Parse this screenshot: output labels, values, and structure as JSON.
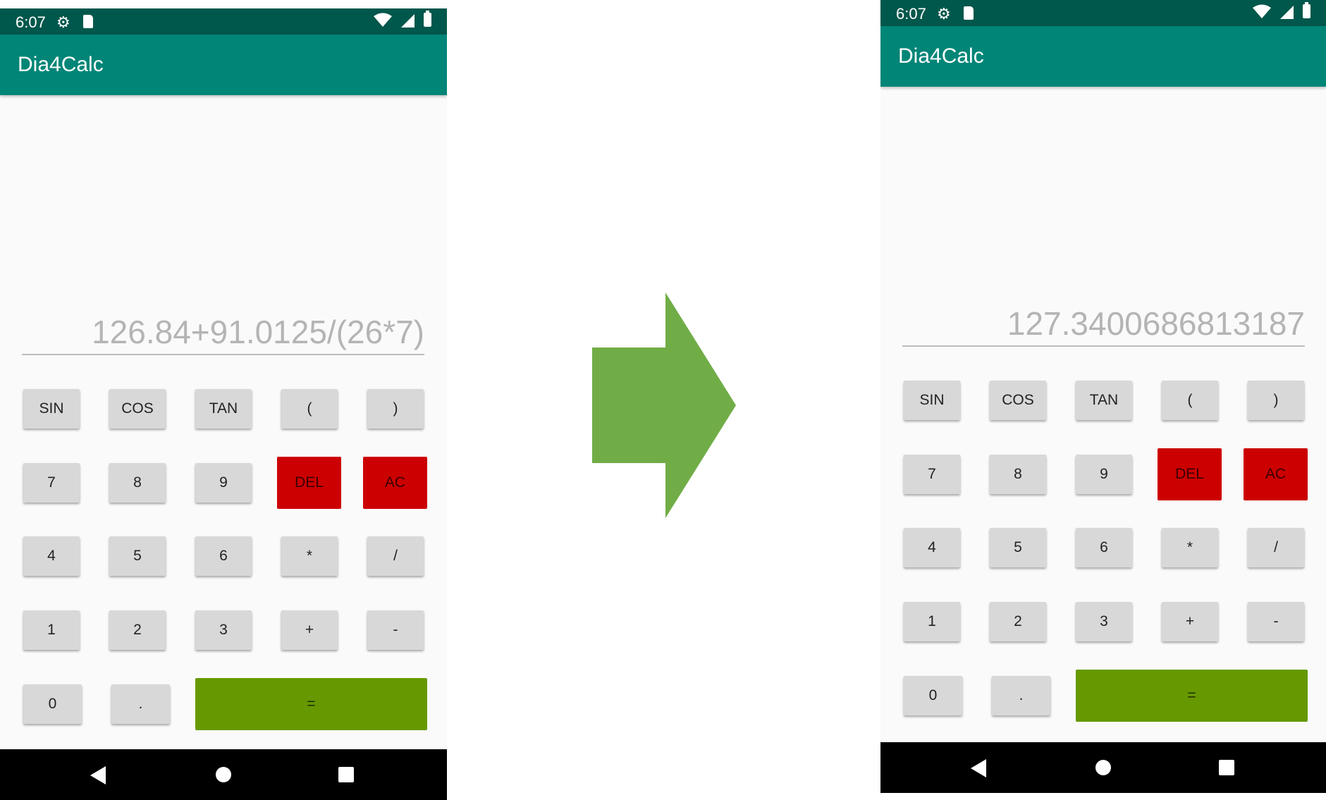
{
  "left_screen": {
    "status_time": "6:07",
    "app_title": "Dia4Calc",
    "display_text": "126.84+91.0125/(26*7)"
  },
  "right_screen": {
    "status_time": "6:07",
    "app_title": "Dia4Calc",
    "display_text": "127.3400686813187"
  },
  "keypad": {
    "sin": "SIN",
    "cos": "COS",
    "tan": "TAN",
    "lparen": "(",
    "rparen": ")",
    "k7": "7",
    "k8": "8",
    "k9": "9",
    "del": "DEL",
    "ac": "AC",
    "k4": "4",
    "k5": "5",
    "k6": "6",
    "mul": "*",
    "div": "/",
    "k1": "1",
    "k2": "2",
    "k3": "3",
    "add": "+",
    "sub": "-",
    "k0": "0",
    "dot": ".",
    "eq": "="
  },
  "icons": [
    "gear-icon",
    "sd-card-icon",
    "wifi-icon",
    "signal-icon",
    "battery-icon",
    "back-icon",
    "home-icon",
    "recents-icon",
    "arrow-right-icon"
  ],
  "colors": {
    "status_bar": "#00574b",
    "app_bar": "#008577",
    "del_ac": "#cc0000",
    "equals": "#669900",
    "arrow": "#70ad47"
  }
}
